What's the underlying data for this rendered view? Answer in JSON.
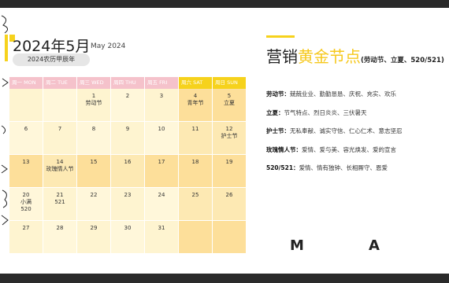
{
  "calendar": {
    "title": "2024年5月",
    "subtitle_en": "May 2024",
    "lunar": "2024农历甲辰年",
    "weekdays": [
      {
        "label": "周一 MON",
        "weekend": false
      },
      {
        "label": "周二 TUE",
        "weekend": false
      },
      {
        "label": "周三 WED",
        "weekend": false
      },
      {
        "label": "周四 THU",
        "weekend": false
      },
      {
        "label": "周五 FRI",
        "weekend": false
      },
      {
        "label": "周六 SAT",
        "weekend": true
      },
      {
        "label": "周日 SUN",
        "weekend": true
      }
    ],
    "rows": [
      [
        {
          "day": "",
          "note": ""
        },
        {
          "day": "",
          "note": ""
        },
        {
          "day": "1",
          "note": "劳动节"
        },
        {
          "day": "2",
          "note": ""
        },
        {
          "day": "3",
          "note": ""
        },
        {
          "day": "4",
          "note": "青年节"
        },
        {
          "day": "5",
          "note": "立夏"
        }
      ],
      [
        {
          "day": "6",
          "note": ""
        },
        {
          "day": "7",
          "note": ""
        },
        {
          "day": "8",
          "note": ""
        },
        {
          "day": "9",
          "note": ""
        },
        {
          "day": "10",
          "note": ""
        },
        {
          "day": "11",
          "note": ""
        },
        {
          "day": "12",
          "note": "护士节"
        }
      ],
      [
        {
          "day": "13",
          "note": ""
        },
        {
          "day": "14",
          "note": "玫瑰情人节"
        },
        {
          "day": "15",
          "note": ""
        },
        {
          "day": "16",
          "note": ""
        },
        {
          "day": "17",
          "note": ""
        },
        {
          "day": "18",
          "note": ""
        },
        {
          "day": "19",
          "note": ""
        }
      ],
      [
        {
          "day": "20",
          "note": "小满\n520"
        },
        {
          "day": "21",
          "note": "521"
        },
        {
          "day": "22",
          "note": ""
        },
        {
          "day": "23",
          "note": ""
        },
        {
          "day": "24",
          "note": ""
        },
        {
          "day": "25",
          "note": ""
        },
        {
          "day": "26",
          "note": ""
        }
      ],
      [
        {
          "day": "27",
          "note": ""
        },
        {
          "day": "28",
          "note": ""
        },
        {
          "day": "29",
          "note": ""
        },
        {
          "day": "30",
          "note": ""
        },
        {
          "day": "31",
          "note": ""
        },
        {
          "day": "",
          "note": ""
        },
        {
          "day": "",
          "note": ""
        }
      ]
    ]
  },
  "marketing": {
    "title_main": "营销",
    "title_gold": "黄金节点",
    "title_sub": "(劳动节、立夏、520/521)",
    "items": [
      {
        "label": "劳动节：",
        "text": "兢兢业业、勤勤恳恳、庆祝、充实、欢乐"
      },
      {
        "label": "立夏：",
        "text": "节气特点、烈日炎炎、三伏暑天"
      },
      {
        "label": "护士节：",
        "text": "无私奉献、诚实守信、仁心仁术、意志坚忍"
      },
      {
        "label": "玫瑰情人节：",
        "text": "爱情、爱与美、容光焕发、爱的宣言"
      },
      {
        "label": "520/521：",
        "text": "爱情、情有独钟、长相厮守、恩爱"
      }
    ]
  },
  "logos": [
    "M",
    "A"
  ],
  "colors": {
    "accent_yellow": "#f6d21c",
    "weekday_header": "#f5c2cb"
  }
}
